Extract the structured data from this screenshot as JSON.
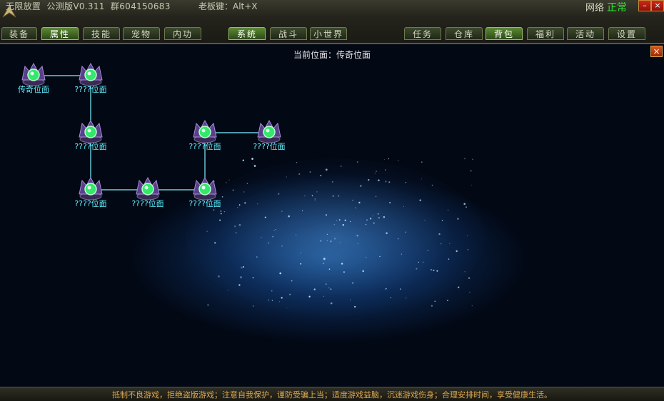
{
  "window": {
    "title": "无限放置  公测版V0.311  群604150683",
    "boss_key": "老板键：Alt+X",
    "network_label": "网络",
    "network_status": "正常",
    "minimize_label": "–",
    "close_label": "×"
  },
  "tabs_left": [
    "装备",
    "属性",
    "技能",
    "宠物",
    "内功"
  ],
  "tabs_mid": [
    "系统",
    "战斗",
    "小世界"
  ],
  "tabs_right": [
    "任务",
    "仓库",
    "背包",
    "福利",
    "活动",
    "设置"
  ],
  "active_tabs": [
    "属性",
    "系统",
    "背包"
  ],
  "map": {
    "current_position": "当前位面：传奇位面",
    "close_label": "×",
    "nodes": [
      {
        "id": "n1",
        "label": "传奇位面",
        "current": true
      },
      {
        "id": "n2",
        "label": "????位面"
      },
      {
        "id": "n3",
        "label": "????位面"
      },
      {
        "id": "n4",
        "label": "????位面"
      },
      {
        "id": "n5",
        "label": "????位面"
      },
      {
        "id": "n6",
        "label": "????位面"
      },
      {
        "id": "n7",
        "label": "????位面"
      },
      {
        "id": "n8",
        "label": "????位面"
      }
    ],
    "links": [
      [
        "n1",
        "n2"
      ],
      [
        "n2",
        "n3"
      ],
      [
        "n3",
        "n4"
      ],
      [
        "n4",
        "n5"
      ],
      [
        "n5",
        "n6"
      ],
      [
        "n6",
        "n7"
      ],
      [
        "n7",
        "n8"
      ]
    ]
  },
  "footer": {
    "notice": "抵制不良游戏，拒绝盗版游戏；注意自我保护，谨防受骗上当；适度游戏益脑，沉迷游戏伤身；合理安排时间，享受健康生活。"
  },
  "colors": {
    "node_label": "#61f1ff",
    "link": "#7ef3ff",
    "network_ok": "#2fe62f"
  }
}
